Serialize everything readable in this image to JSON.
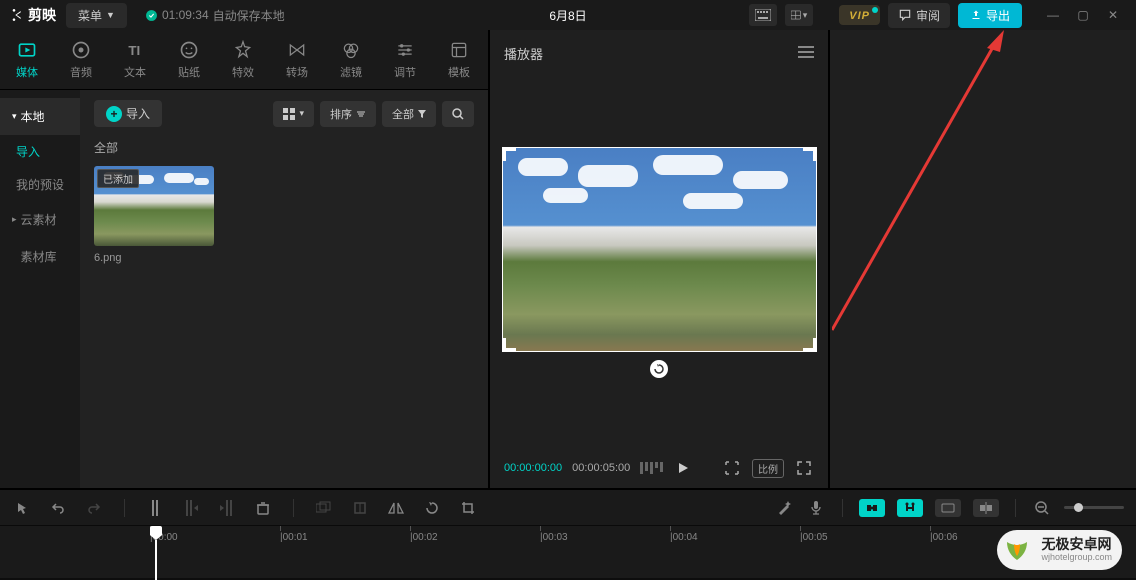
{
  "topbar": {
    "app_name": "剪映",
    "menu_label": "菜单",
    "save_time": "01:09:34",
    "save_status": "自动保存本地",
    "title": "6月8日",
    "vip_label": "VIP",
    "review_label": "审阅",
    "export_label": "导出"
  },
  "tool_tabs": [
    {
      "id": "media",
      "label": "媒体"
    },
    {
      "id": "audio",
      "label": "音频"
    },
    {
      "id": "text",
      "label": "文本"
    },
    {
      "id": "sticker",
      "label": "贴纸"
    },
    {
      "id": "effect",
      "label": "特效"
    },
    {
      "id": "transition",
      "label": "转场"
    },
    {
      "id": "filter",
      "label": "滤镜"
    },
    {
      "id": "adjust",
      "label": "调节"
    },
    {
      "id": "template",
      "label": "模板"
    }
  ],
  "sidebar": {
    "local": "本地",
    "import": "导入",
    "my_presets": "我的预设",
    "cloud": "云素材",
    "library": "素材库"
  },
  "media": {
    "import_btn": "导入",
    "sort": "排序",
    "filter_all": "全部",
    "all_label": "全部",
    "added_tag": "已添加",
    "thumb_name": "6.png"
  },
  "player": {
    "title": "播放器",
    "current_time": "00:00:00:00",
    "duration": "00:00:05:00",
    "ratio": "比例"
  },
  "timeline": {
    "ticks": [
      "|00:00",
      "|00:01",
      "|00:02",
      "|00:03",
      "|00:04",
      "|00:05",
      "|00:06"
    ]
  },
  "watermark": {
    "main": "无极安卓网",
    "sub": "wjhotelgroup.com"
  }
}
